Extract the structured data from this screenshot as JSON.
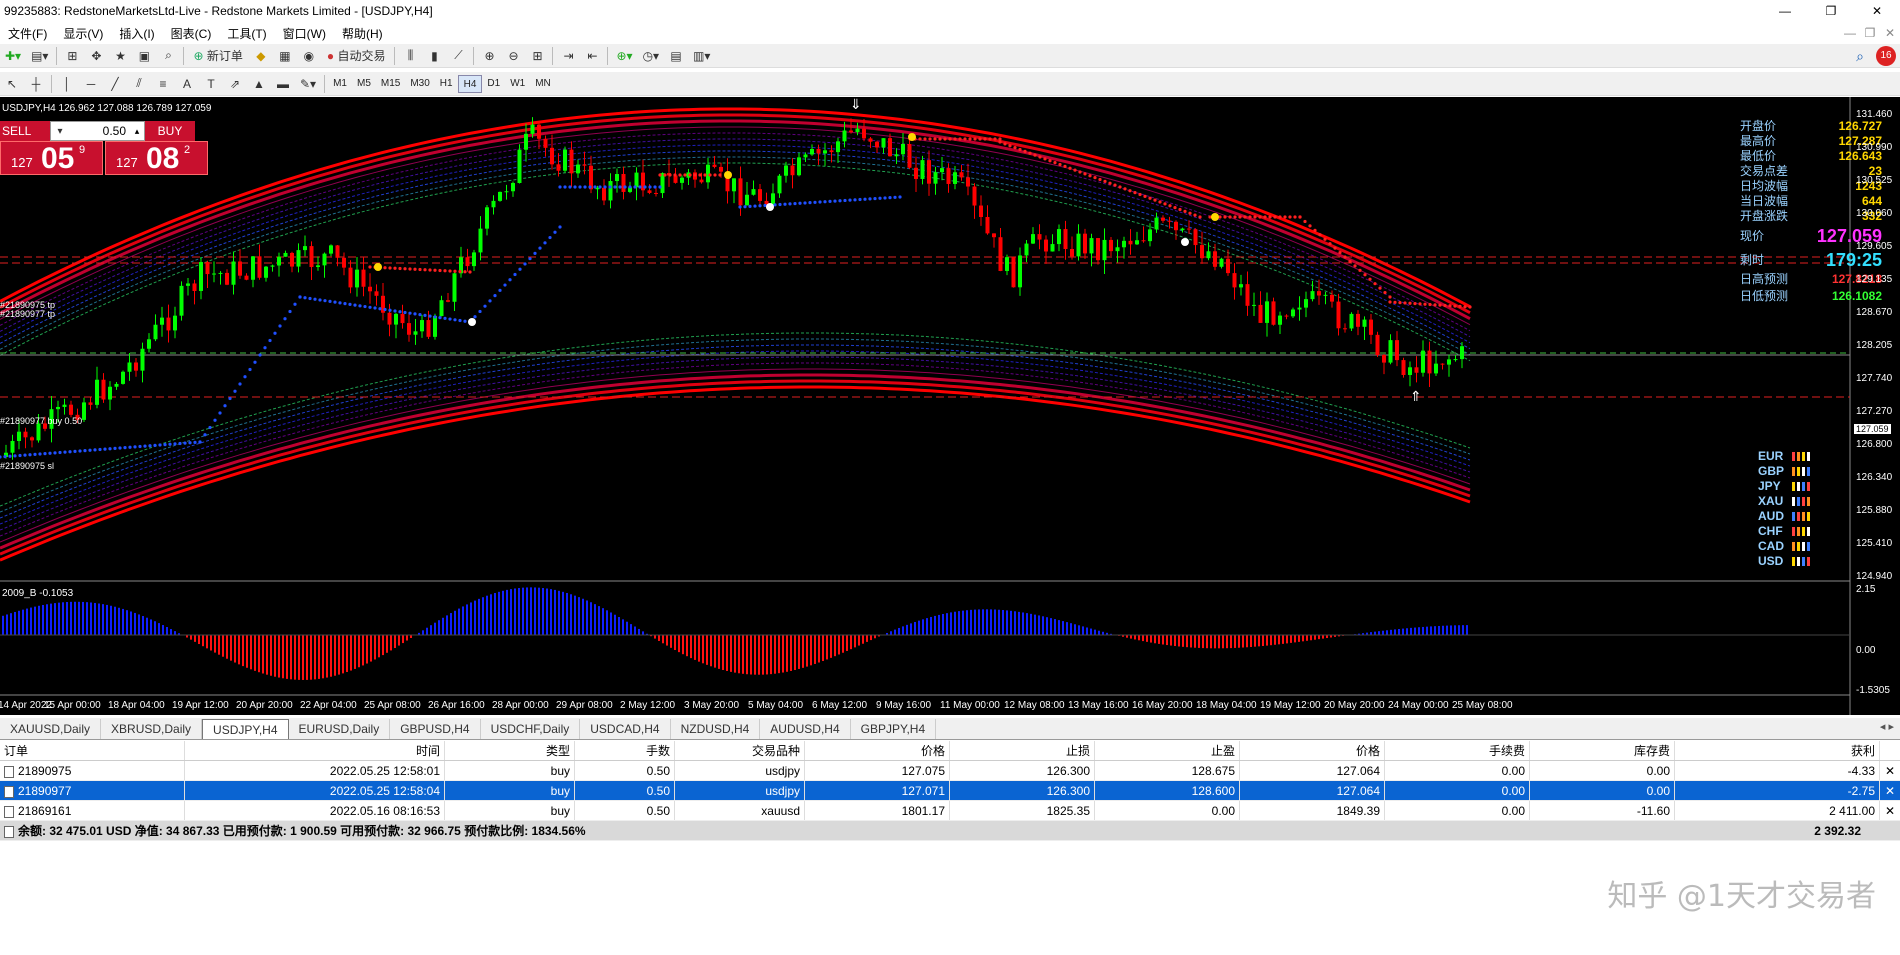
{
  "window": {
    "title": "99235883: RedstoneMarketsLtd-Live - Redstone Markets Limited - [USDJPY,H4]",
    "controls": [
      "—",
      "❐",
      "✕"
    ]
  },
  "menu": [
    "文件(F)",
    "显示(V)",
    "插入(I)",
    "图表(C)",
    "工具(T)",
    "窗口(W)",
    "帮助(H)"
  ],
  "toolbar": {
    "new_order": "新订单",
    "auto_trade": "自动交易"
  },
  "timeframes": [
    "M1",
    "M5",
    "M15",
    "M30",
    "H1",
    "H4",
    "D1",
    "W1",
    "MN"
  ],
  "active_timeframe": "H4",
  "chart": {
    "info": "USDJPY,H4  126.962 127.088 126.789 127.059",
    "sell_label": "SELL",
    "buy_label": "BUY",
    "lot": "0.50",
    "sell_price": {
      "prefix": "127",
      "big": "05",
      "sup": "9"
    },
    "buy_price": {
      "prefix": "127",
      "big": "08",
      "sup": "2"
    },
    "panel": [
      {
        "label": "开盘价",
        "value": "126.727"
      },
      {
        "label": "最高价",
        "value": "127.287"
      },
      {
        "label": "最低价",
        "value": "126.643"
      },
      {
        "label": "交易点差",
        "value": "23"
      },
      {
        "label": "日均波幅",
        "value": "1243"
      },
      {
        "label": "当日波幅",
        "value": "644"
      },
      {
        "label": "开盘涨跌",
        "value": "332"
      }
    ],
    "current_label": "现价",
    "current_value": "127.059",
    "countdown_label": "剩时",
    "countdown_value": "179:25",
    "high_forecast_label": "日高预测",
    "high_forecast_value": "127.8218",
    "low_forecast_label": "日低预测",
    "low_forecast_value": "126.1082",
    "price_axis": [
      "131.460",
      "130.990",
      "130.525",
      "130.060",
      "129.605",
      "129.135",
      "128.670",
      "128.205",
      "127.740",
      "127.270",
      "126.800",
      "126.340",
      "125.880",
      "125.410",
      "124.940"
    ],
    "price_tag": "127.059",
    "line_labels": {
      "tp1": "#21890975 tp",
      "tp2": "#21890977 tp",
      "buy": "#21890977 buy 0.50",
      "sl": "#21890975 sl"
    },
    "currencies": [
      "EUR",
      "GBP",
      "JPY",
      "XAU",
      "AUD",
      "CHF",
      "CAD",
      "USD"
    ],
    "sub_info": "2009_B -0.1053",
    "sub_axis": [
      "2.15",
      "0.00",
      "-1.5305"
    ],
    "x_axis": [
      "14 Apr 2022",
      "15 Apr 00:00",
      "18 Apr 04:00",
      "19 Apr 12:00",
      "20 Apr 20:00",
      "22 Apr 04:00",
      "25 Apr 08:00",
      "26 Apr 16:00",
      "28 Apr 00:00",
      "29 Apr 08:00",
      "2 May 12:00",
      "3 May 20:00",
      "5 May 04:00",
      "6 May 12:00",
      "9 May 16:00",
      "11 May 00:00",
      "12 May 08:00",
      "13 May 16:00",
      "16 May 20:00",
      "18 May 04:00",
      "19 May 12:00",
      "20 May 20:00",
      "24 May 00:00",
      "25 May 08:00"
    ]
  },
  "chart_tabs": [
    "XAUUSD,Daily",
    "XBRUSD,Daily",
    "USDJPY,H4",
    "EURUSD,Daily",
    "GBPUSD,H4",
    "USDCHF,Daily",
    "USDCAD,H4",
    "NZDUSD,H4",
    "AUDUSD,H4",
    "GBPJPY,H4"
  ],
  "active_tab": "USDJPY,H4",
  "terminal": {
    "columns": [
      "订单",
      "时间",
      "类型",
      "手数",
      "交易品种",
      "价格",
      "止损",
      "止盈",
      "价格",
      "手续费",
      "库存费",
      "获利"
    ],
    "rows": [
      [
        "21890975",
        "2022.05.25 12:58:01",
        "buy",
        "0.50",
        "usdjpy",
        "127.075",
        "126.300",
        "128.675",
        "127.064",
        "0.00",
        "0.00",
        "-4.33"
      ],
      [
        "21890977",
        "2022.05.25 12:58:04",
        "buy",
        "0.50",
        "usdjpy",
        "127.071",
        "126.300",
        "128.600",
        "127.064",
        "0.00",
        "0.00",
        "-2.75"
      ],
      [
        "21869161",
        "2022.05.16 08:16:53",
        "buy",
        "0.50",
        "xauusd",
        "1801.17",
        "1825.35",
        "0.00",
        "1849.39",
        "0.00",
        "-11.60",
        "2 411.00"
      ]
    ],
    "summary": "余额: 32 475.01 USD  净值: 34 867.33  已用预付款: 1 900.59  可用预付款: 32 966.75  预付款比例: 1834.56%",
    "summary_total": "2 392.32"
  },
  "watermark": "知乎 @1天才交易者"
}
